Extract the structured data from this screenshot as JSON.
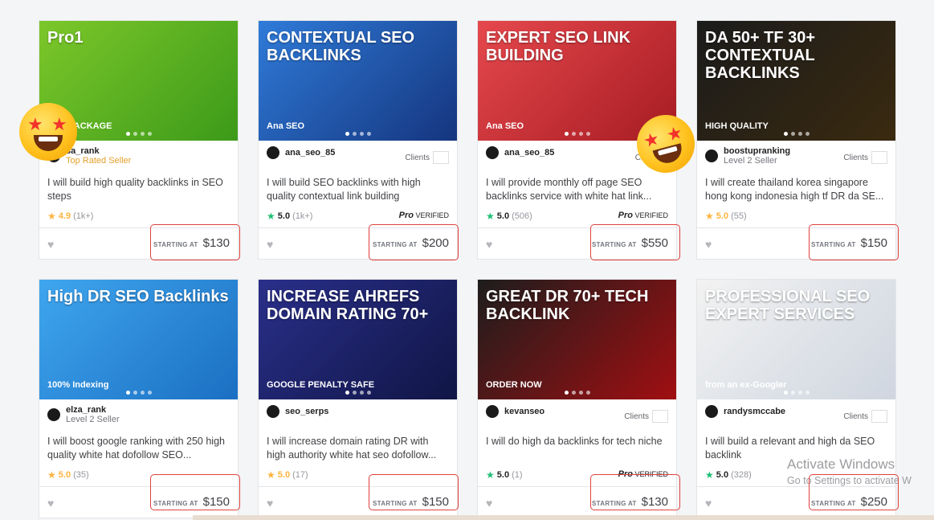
{
  "gigs": [
    {
      "thumb_title": "Pro1",
      "thumb_sub": "SEO PACKAGE",
      "thumb_bg": "linear-gradient(135deg,#7cc72a,#3c9a19)",
      "seller": "sa_rank",
      "level": "Top Rated Seller",
      "level_top": true,
      "show_clients": false,
      "description": "I will build high quality backlinks in SEO steps",
      "rating": "4.9",
      "rating_count": "(1k+)",
      "star_green": false,
      "pro": false,
      "price_label": "STARTING AT",
      "price": "$130"
    },
    {
      "thumb_title": "CONTEXTUAL SEO BACKLINKS",
      "thumb_sub": "Ana SEO",
      "thumb_bg": "linear-gradient(135deg,#2f7bd9,#15357e)",
      "seller": "ana_seo_85",
      "level": "",
      "show_clients": true,
      "clients_label": "Clients",
      "description": "I will build SEO backlinks with high quality contextual link building",
      "rating": "5.0",
      "rating_count": "(1k+)",
      "star_green": true,
      "pro": true,
      "pro_label": "Pro",
      "verified_label": "VERIFIED",
      "price_label": "STARTING AT",
      "price": "$200"
    },
    {
      "thumb_title": "EXPERT SEO LINK BUILDING",
      "thumb_sub": "Ana SEO",
      "thumb_bg": "linear-gradient(135deg,#e5484d,#a61c22)",
      "seller": "ana_seo_85",
      "level": "",
      "show_clients": true,
      "clients_label": "Clie",
      "description": "I will provide monthly off page SEO backlinks service with white hat link...",
      "rating": "5.0",
      "rating_count": "(506)",
      "star_green": true,
      "pro": true,
      "pro_label": "Pro",
      "verified_label": "VERIFIED",
      "price_label": "STARTING AT",
      "price": "$550"
    },
    {
      "thumb_title": "DA 50+ TF 30+ CONTEXTUAL BACKLINKS",
      "thumb_sub": "HIGH QUALITY",
      "thumb_bg": "linear-gradient(135deg,#1b1b1b,#3a2a10)",
      "seller": "boostupranking",
      "level": "Level 2 Seller",
      "show_clients": true,
      "clients_label": "Clients",
      "description": "I will create thailand korea singapore hong kong indonesia high tf DR da SE...",
      "rating": "5.0",
      "rating_count": "(55)",
      "star_green": false,
      "pro": false,
      "price_label": "STARTING AT",
      "price": "$150"
    },
    {
      "thumb_title": "High DR SEO Backlinks",
      "thumb_sub": "100% Indexing",
      "thumb_bg": "linear-gradient(135deg,#3fa6ef,#1b6fc2)",
      "seller": "elza_rank",
      "level": "Level 2 Seller",
      "show_clients": false,
      "description": "I will boost google ranking with 250 high quality white hat dofollow SEO...",
      "rating": "5.0",
      "rating_count": "(35)",
      "star_green": false,
      "pro": false,
      "price_label": "STARTING AT",
      "price": "$150"
    },
    {
      "thumb_title": "INCREASE AHREFS DOMAIN RATING 70+",
      "thumb_sub": "GOOGLE PENALTY SAFE",
      "thumb_bg": "linear-gradient(135deg,#2a2f8a,#101545)",
      "seller": "seo_serps",
      "level": "",
      "show_clients": false,
      "description": "I will increase domain rating DR with high authority white hat seo dofollow...",
      "rating": "5.0",
      "rating_count": "(17)",
      "star_green": false,
      "pro": false,
      "price_label": "STARTING AT",
      "price": "$150"
    },
    {
      "thumb_title": "GREAT DR 70+ TECH BACKLINK",
      "thumb_sub": "ORDER NOW",
      "thumb_bg": "linear-gradient(135deg,#1d1d1d,#a00f12)",
      "seller": "kevanseo",
      "level": "",
      "show_clients": true,
      "clients_label": "Clients",
      "description": "I will do high da backlinks for tech niche",
      "rating": "5.0",
      "rating_count": "(1)",
      "star_green": true,
      "pro": true,
      "pro_label": "Pro",
      "verified_label": "VERIFIED",
      "price_label": "STARTING AT",
      "price": "$130"
    },
    {
      "thumb_title": "PROFESSIONAL SEO EXPERT SERVICES",
      "thumb_sub": "from an ex-Googler",
      "thumb_bg": "linear-gradient(135deg,#f2f2f2,#cfd6e0)",
      "seller": "randysmccabe",
      "level": "",
      "show_clients": true,
      "clients_label": "Clients",
      "description": "I will build a relevant and high da SEO backlink",
      "rating": "5.0",
      "rating_count": "(328)",
      "star_green": true,
      "pro": false,
      "price_label": "STARTING AT",
      "price": "$250"
    }
  ],
  "watermark": {
    "line1": "Activate Windows",
    "line2": "Go to Settings to activate W"
  },
  "colors": {
    "highlight": "#e0413c",
    "accent_green": "#1dbf73",
    "star_orange": "#ffb33e"
  }
}
